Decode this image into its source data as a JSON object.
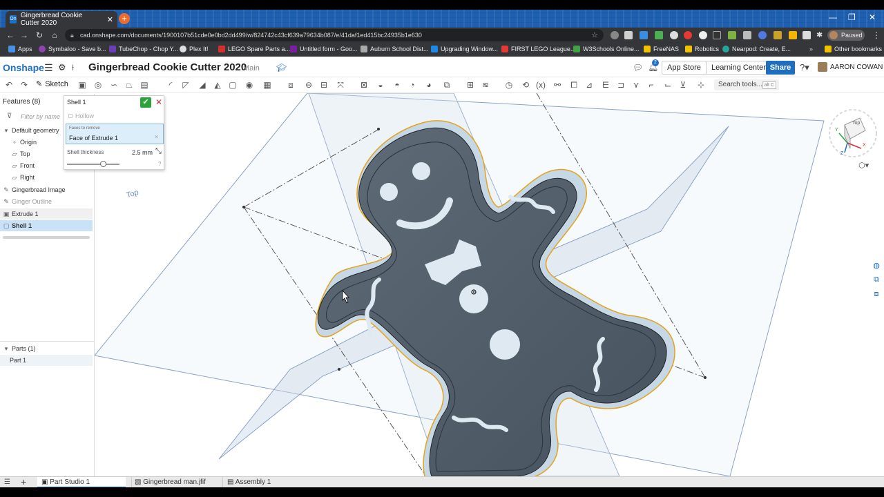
{
  "browser": {
    "tab_title": "Gingerbread Cookie Cutter 2020",
    "tab_icon_text": "On",
    "url": "cad.onshape.com/documents/1900107b51cde0e0bd2dd499/w/824742c43cf639a79634b087/e/41daf1ed415bc24935b1e630",
    "profile_label": "Paused",
    "bookmarks": [
      "Apps",
      "Symbaloo - Save b...",
      "TubeChop - Chop Y...",
      "Plex It!",
      "LEGO Spare Parts a...",
      "Untitled form - Goo...",
      "Auburn School Dist...",
      "Upgrading Window...",
      "FIRST LEGO League...",
      "W3Schools Online...",
      "FreeNAS",
      "Robotics",
      "Nearpod: Create, E...",
      "Other bookmarks"
    ]
  },
  "header": {
    "logo": "Onshape",
    "doc_title": "Gingerbread Cookie Cutter 2020",
    "branch": "Main",
    "notification_count": "2",
    "app_store": "App Store",
    "learning_center": "Learning Center",
    "share": "Share",
    "user": "AARON COWAN"
  },
  "toolbar": {
    "sketch": "Sketch",
    "search_tools": "Search tools...",
    "search_shortcut": "alt C"
  },
  "features": {
    "title": "Features (8)",
    "filter_placeholder": "Filter by name o",
    "items": [
      {
        "label": "Default geometry"
      },
      {
        "label": "Origin"
      },
      {
        "label": "Top"
      },
      {
        "label": "Front"
      },
      {
        "label": "Right"
      },
      {
        "label": "Gingerbread Image"
      },
      {
        "label": "Ginger Outline"
      },
      {
        "label": "Extrude 1"
      },
      {
        "label": "Shell 1"
      }
    ],
    "parts_title": "Parts (1)",
    "parts": [
      {
        "label": "Part 1"
      }
    ]
  },
  "shell_dialog": {
    "title": "Shell 1",
    "hollow": "Hollow",
    "faces_label": "Faces to remove",
    "faces_value": "Face of Extrude 1",
    "thickness_label": "Shell thickness",
    "thickness_value": "2.5 mm"
  },
  "viewport": {
    "plane_label": "Top",
    "view_cube_label": "Top",
    "axis_x": "X",
    "axis_y": "Y",
    "axis_z": "Z"
  },
  "bottom_tabs": [
    {
      "label": "Part Studio 1"
    },
    {
      "label": "Gingerbread man.jfif"
    },
    {
      "label": "Assembly 1"
    }
  ],
  "colors": {
    "onshape_blue": "#1f6fc0",
    "selection_blue": "#c9e2f7",
    "ok_green": "#2aa43a",
    "outline_orange": "#e5a21a",
    "cookie_body": "#4e5a66"
  }
}
